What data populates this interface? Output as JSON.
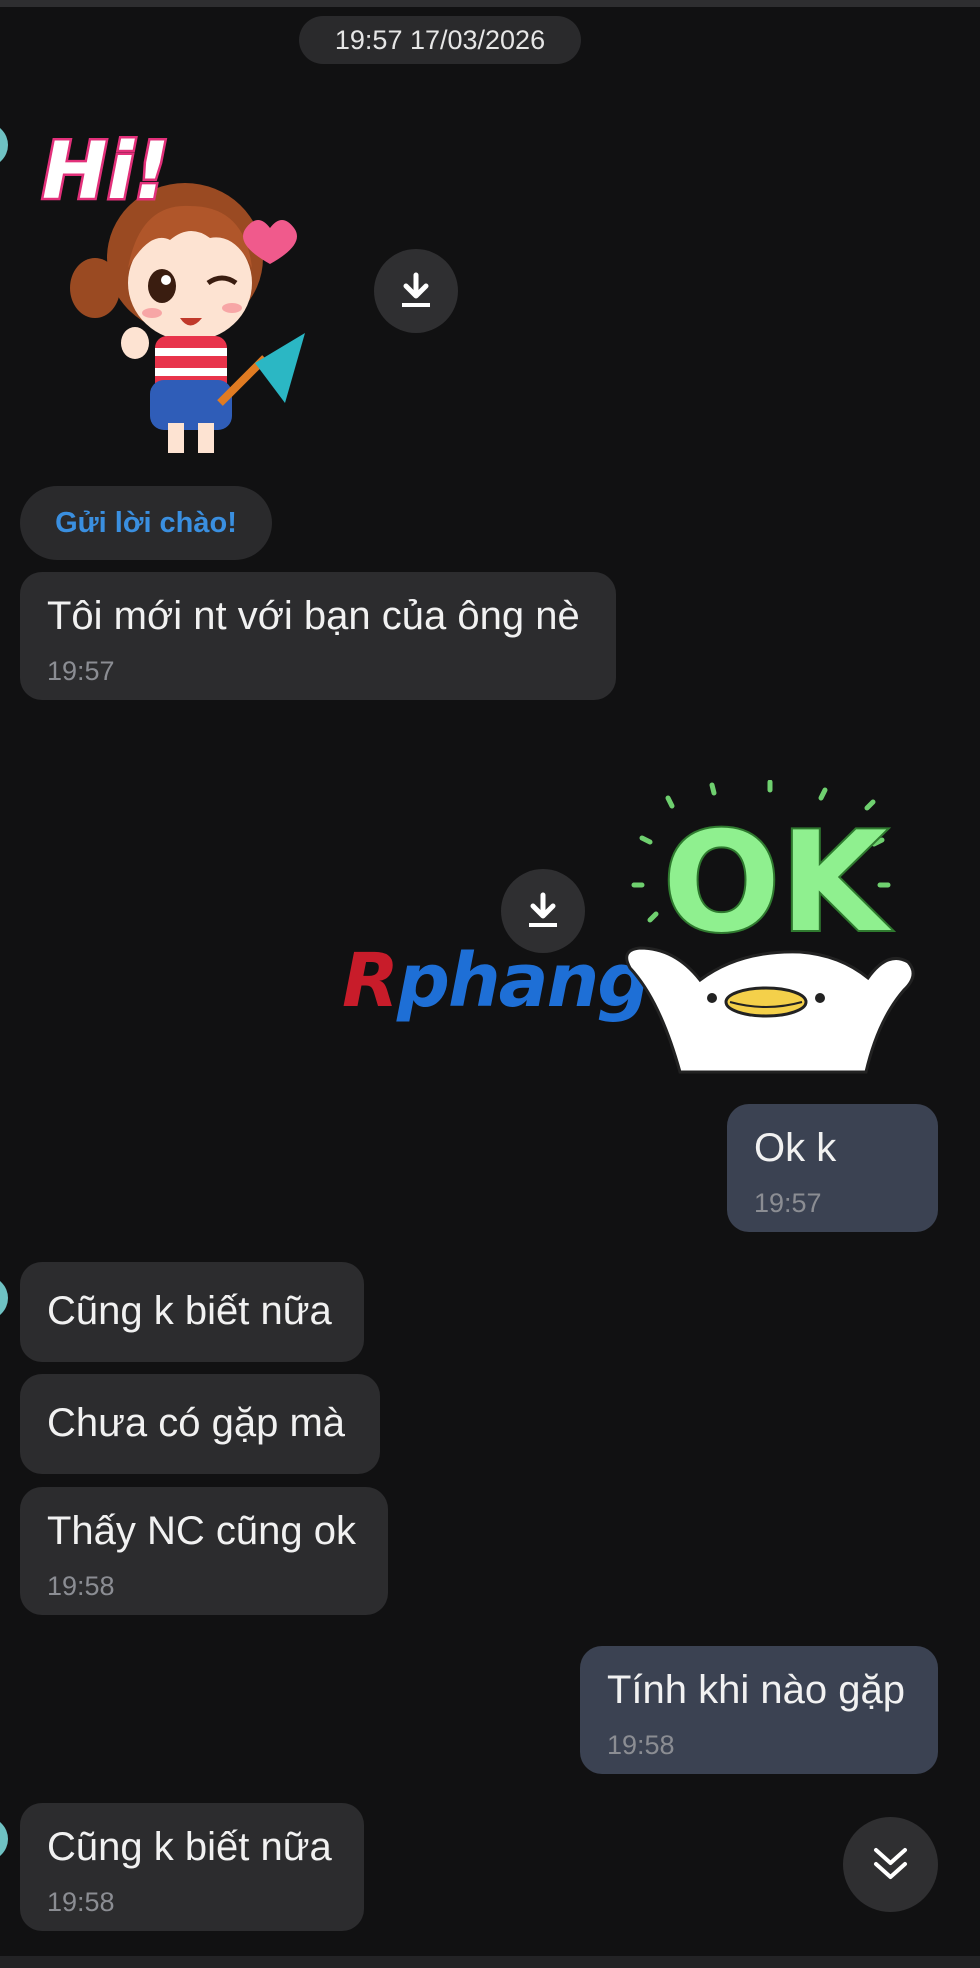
{
  "chat": {
    "date_separator": "19:57 17/03/2026",
    "sticker_hi": {
      "caption": "Hi!"
    },
    "sticker_ok": {
      "caption": "OK",
      "watermark": "Rphang"
    },
    "greet_button": "Gửi lời chào!",
    "messages": [
      {
        "text": "Tôi mới nt với bạn của ông nè",
        "time": "19:57",
        "direction": "incoming"
      },
      {
        "text": "Ok k",
        "time": "19:57",
        "direction": "outgoing"
      },
      {
        "text": "Cũng k biết nữa",
        "time": "",
        "direction": "incoming"
      },
      {
        "text": "Chưa có gặp mà",
        "time": "",
        "direction": "incoming"
      },
      {
        "text": "Thấy NC cũng ok",
        "time": "19:58",
        "direction": "incoming"
      },
      {
        "text": "Tính khi nào gặp",
        "time": "19:58",
        "direction": "outgoing"
      },
      {
        "text": "Cũng k biết nữa",
        "time": "19:58",
        "direction": "incoming"
      }
    ]
  },
  "icons": {
    "download": "download-icon",
    "scroll_down": "double-chevron-down-icon"
  },
  "colors": {
    "background": "#111112",
    "incoming_bubble": "#2c2c2e",
    "outgoing_bubble": "#3b4252",
    "link_blue": "#3a8fe0",
    "timestamp": "#8b8d93"
  }
}
